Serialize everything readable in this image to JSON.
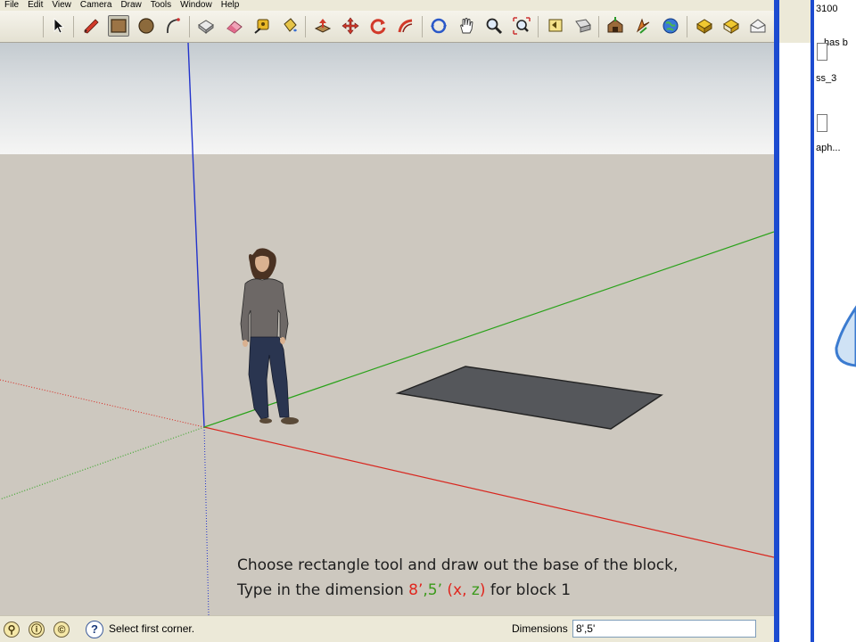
{
  "menu": [
    "File",
    "Edit",
    "View",
    "Camera",
    "Draw",
    "Tools",
    "Window",
    "Help"
  ],
  "toolbar": {
    "tools": [
      "select",
      "pencil",
      "rectangle",
      "circle",
      "arc",
      "make-component",
      "eraser",
      "tape-measure",
      "paint-bucket",
      "push-pull",
      "move",
      "rotate",
      "follow-me",
      "orbit",
      "pan",
      "zoom",
      "zoom-extents",
      "previous-view",
      "next-view",
      "3d-warehouse",
      "component",
      "share-model",
      "get-models",
      "standard-view",
      "standard-view-2"
    ],
    "active_tool": "rectangle"
  },
  "viewport": {
    "instructions": {
      "line1": "Choose rectangle tool and draw out the base of the block,",
      "line2_prefix": "Type in the dimension ",
      "line2_x": "8’",
      "line2_comma": ",",
      "line2_z": "5’",
      "line2_space": " ",
      "line2_paren_open": "(",
      "line2_xlabel": "x",
      "line2_sep": ", ",
      "line2_zlabel": "z",
      "line2_paren_close": ")",
      "line2_suffix": " for block 1"
    },
    "colors": {
      "sky": "#dfe3e6",
      "ground": "#cdc8bf",
      "x_axis": "#d8261e",
      "y_axis": "#2aa21a",
      "z_axis": "#2233cc",
      "rectangle_fill": "#55575b"
    }
  },
  "statusbar": {
    "status": "Select first corner.",
    "dimensions_label": "Dimensions",
    "dimensions_value": "8',5'"
  },
  "right_window": {
    "text1": "3100",
    "text2": "has b",
    "text3": "ss_3",
    "text4": "aph..."
  }
}
